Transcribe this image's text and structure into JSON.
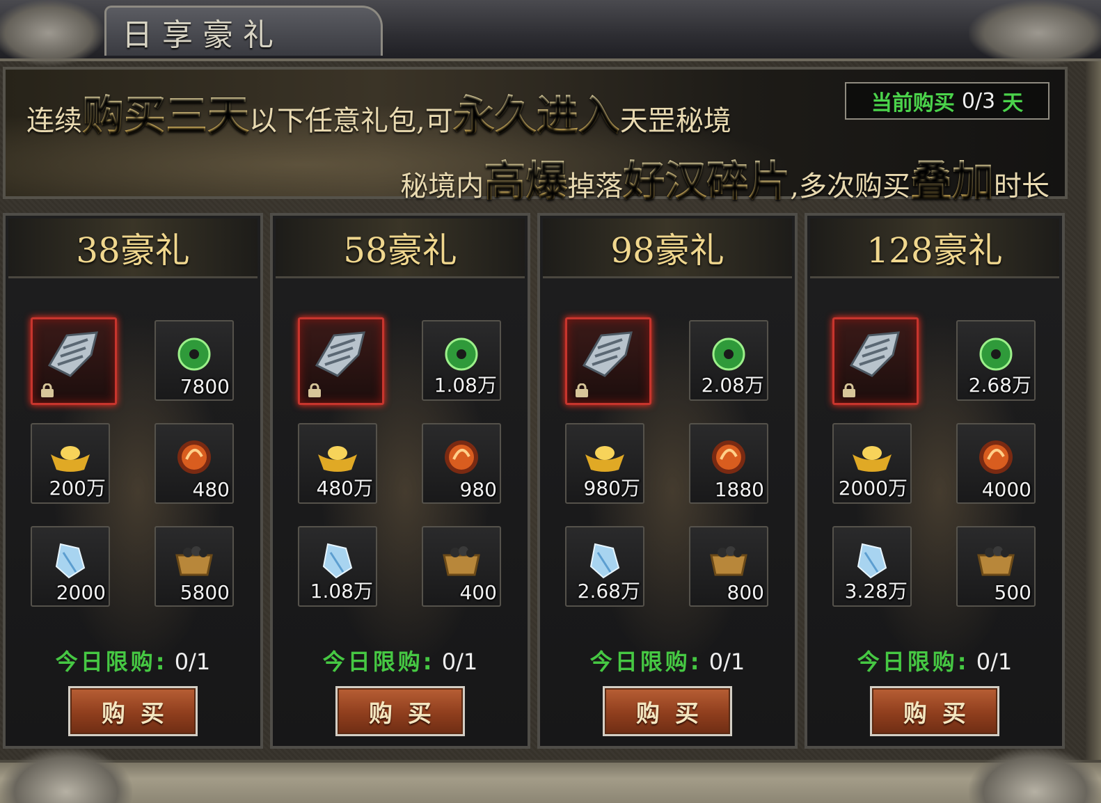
{
  "window": {
    "title": "日享豪礼"
  },
  "banner": {
    "line1": {
      "p1": "连续",
      "h1": "购买三天",
      "p2": "以下任意礼包,可",
      "h2": "永久进入",
      "p3": "天罡秘境"
    },
    "line2": {
      "p1": "秘境内",
      "h1": "高爆",
      "p2": "掉落",
      "h2": "好汉碎片",
      "p3": ",多次购买",
      "h3": "叠加",
      "p4": "时长"
    },
    "status": {
      "label": "当前购买",
      "value": "0/3",
      "unit": "天"
    }
  },
  "packs": [
    {
      "title": "38豪礼",
      "items": {
        "shard": "",
        "jade": "7800",
        "gold": "200万",
        "orb": "480",
        "gem": "2000",
        "scroll": "5800"
      },
      "limit_label": "今日限购:",
      "limit_value": "0/1",
      "buy_label": "购买"
    },
    {
      "title": "58豪礼",
      "items": {
        "shard": "",
        "jade": "1.08万",
        "gold": "480万",
        "orb": "980",
        "gem": "1.08万",
        "scroll": "400"
      },
      "limit_label": "今日限购:",
      "limit_value": "0/1",
      "buy_label": "购买"
    },
    {
      "title": "98豪礼",
      "items": {
        "shard": "",
        "jade": "2.08万",
        "gold": "980万",
        "orb": "1880",
        "gem": "2.68万",
        "scroll": "800"
      },
      "limit_label": "今日限购:",
      "limit_value": "0/1",
      "buy_label": "购买"
    },
    {
      "title": "128豪礼",
      "items": {
        "shard": "",
        "jade": "2.68万",
        "gold": "2000万",
        "orb": "4000",
        "gem": "3.28万",
        "scroll": "500"
      },
      "limit_label": "今日限购:",
      "limit_value": "0/1",
      "buy_label": "购买"
    }
  ],
  "icons": [
    "lock-icon",
    "armor-shard-icon",
    "jade-disc-icon",
    "gold-ingot-icon",
    "fire-orb-icon",
    "ice-crystal-icon",
    "relic-icon"
  ],
  "colors": {
    "accent_gold": "#f0d78e",
    "limit_green": "#46c843",
    "status_green": "#4bd34b",
    "buy_button": "#a14a25",
    "special_border": "#c7352d"
  }
}
